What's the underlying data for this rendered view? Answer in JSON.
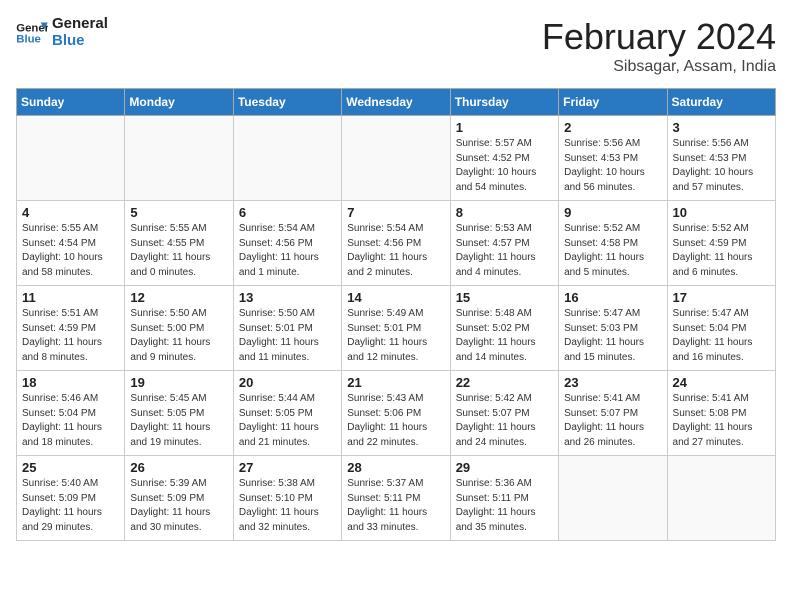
{
  "header": {
    "logo_line1": "General",
    "logo_line2": "Blue",
    "month": "February 2024",
    "location": "Sibsagar, Assam, India"
  },
  "weekdays": [
    "Sunday",
    "Monday",
    "Tuesday",
    "Wednesday",
    "Thursday",
    "Friday",
    "Saturday"
  ],
  "weeks": [
    [
      {
        "day": "",
        "info": ""
      },
      {
        "day": "",
        "info": ""
      },
      {
        "day": "",
        "info": ""
      },
      {
        "day": "",
        "info": ""
      },
      {
        "day": "1",
        "info": "Sunrise: 5:57 AM\nSunset: 4:52 PM\nDaylight: 10 hours\nand 54 minutes."
      },
      {
        "day": "2",
        "info": "Sunrise: 5:56 AM\nSunset: 4:53 PM\nDaylight: 10 hours\nand 56 minutes."
      },
      {
        "day": "3",
        "info": "Sunrise: 5:56 AM\nSunset: 4:53 PM\nDaylight: 10 hours\nand 57 minutes."
      }
    ],
    [
      {
        "day": "4",
        "info": "Sunrise: 5:55 AM\nSunset: 4:54 PM\nDaylight: 10 hours\nand 58 minutes."
      },
      {
        "day": "5",
        "info": "Sunrise: 5:55 AM\nSunset: 4:55 PM\nDaylight: 11 hours\nand 0 minutes."
      },
      {
        "day": "6",
        "info": "Sunrise: 5:54 AM\nSunset: 4:56 PM\nDaylight: 11 hours\nand 1 minute."
      },
      {
        "day": "7",
        "info": "Sunrise: 5:54 AM\nSunset: 4:56 PM\nDaylight: 11 hours\nand 2 minutes."
      },
      {
        "day": "8",
        "info": "Sunrise: 5:53 AM\nSunset: 4:57 PM\nDaylight: 11 hours\nand 4 minutes."
      },
      {
        "day": "9",
        "info": "Sunrise: 5:52 AM\nSunset: 4:58 PM\nDaylight: 11 hours\nand 5 minutes."
      },
      {
        "day": "10",
        "info": "Sunrise: 5:52 AM\nSunset: 4:59 PM\nDaylight: 11 hours\nand 6 minutes."
      }
    ],
    [
      {
        "day": "11",
        "info": "Sunrise: 5:51 AM\nSunset: 4:59 PM\nDaylight: 11 hours\nand 8 minutes."
      },
      {
        "day": "12",
        "info": "Sunrise: 5:50 AM\nSunset: 5:00 PM\nDaylight: 11 hours\nand 9 minutes."
      },
      {
        "day": "13",
        "info": "Sunrise: 5:50 AM\nSunset: 5:01 PM\nDaylight: 11 hours\nand 11 minutes."
      },
      {
        "day": "14",
        "info": "Sunrise: 5:49 AM\nSunset: 5:01 PM\nDaylight: 11 hours\nand 12 minutes."
      },
      {
        "day": "15",
        "info": "Sunrise: 5:48 AM\nSunset: 5:02 PM\nDaylight: 11 hours\nand 14 minutes."
      },
      {
        "day": "16",
        "info": "Sunrise: 5:47 AM\nSunset: 5:03 PM\nDaylight: 11 hours\nand 15 minutes."
      },
      {
        "day": "17",
        "info": "Sunrise: 5:47 AM\nSunset: 5:04 PM\nDaylight: 11 hours\nand 16 minutes."
      }
    ],
    [
      {
        "day": "18",
        "info": "Sunrise: 5:46 AM\nSunset: 5:04 PM\nDaylight: 11 hours\nand 18 minutes."
      },
      {
        "day": "19",
        "info": "Sunrise: 5:45 AM\nSunset: 5:05 PM\nDaylight: 11 hours\nand 19 minutes."
      },
      {
        "day": "20",
        "info": "Sunrise: 5:44 AM\nSunset: 5:05 PM\nDaylight: 11 hours\nand 21 minutes."
      },
      {
        "day": "21",
        "info": "Sunrise: 5:43 AM\nSunset: 5:06 PM\nDaylight: 11 hours\nand 22 minutes."
      },
      {
        "day": "22",
        "info": "Sunrise: 5:42 AM\nSunset: 5:07 PM\nDaylight: 11 hours\nand 24 minutes."
      },
      {
        "day": "23",
        "info": "Sunrise: 5:41 AM\nSunset: 5:07 PM\nDaylight: 11 hours\nand 26 minutes."
      },
      {
        "day": "24",
        "info": "Sunrise: 5:41 AM\nSunset: 5:08 PM\nDaylight: 11 hours\nand 27 minutes."
      }
    ],
    [
      {
        "day": "25",
        "info": "Sunrise: 5:40 AM\nSunset: 5:09 PM\nDaylight: 11 hours\nand 29 minutes."
      },
      {
        "day": "26",
        "info": "Sunrise: 5:39 AM\nSunset: 5:09 PM\nDaylight: 11 hours\nand 30 minutes."
      },
      {
        "day": "27",
        "info": "Sunrise: 5:38 AM\nSunset: 5:10 PM\nDaylight: 11 hours\nand 32 minutes."
      },
      {
        "day": "28",
        "info": "Sunrise: 5:37 AM\nSunset: 5:11 PM\nDaylight: 11 hours\nand 33 minutes."
      },
      {
        "day": "29",
        "info": "Sunrise: 5:36 AM\nSunset: 5:11 PM\nDaylight: 11 hours\nand 35 minutes."
      },
      {
        "day": "",
        "info": ""
      },
      {
        "day": "",
        "info": ""
      }
    ]
  ]
}
